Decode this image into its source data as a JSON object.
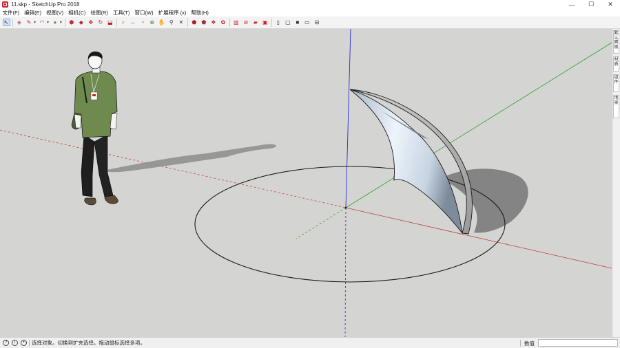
{
  "window": {
    "title": "11.skp - SketchUp Pro 2018",
    "controls": {
      "minimize": "—",
      "maximize": "☐",
      "close": "✕"
    }
  },
  "menu": [
    {
      "label": "文件(F)"
    },
    {
      "label": "编辑(E)"
    },
    {
      "label": "视图(V)"
    },
    {
      "label": "相机(C)"
    },
    {
      "label": "绘图(R)"
    },
    {
      "label": "工具(T)"
    },
    {
      "label": "窗口(W)"
    },
    {
      "label": "扩展程序 (x)"
    },
    {
      "label": "帮助(H)"
    }
  ],
  "toolbar": {
    "items": [
      {
        "name": "select-tool-icon",
        "glyph": "↖",
        "color": "#1a1a1a",
        "selected": true
      },
      {
        "name": "eraser-tool-icon",
        "glyph": "◈",
        "color": "#d0406c"
      },
      {
        "name": "line-tool-icon",
        "glyph": "✎",
        "color": "#b02020",
        "caret": true
      },
      {
        "name": "arc-tool-icon",
        "glyph": "◠",
        "color": "#c03030",
        "caret": true
      },
      {
        "name": "shape-tool-icon",
        "glyph": "●",
        "color": "#8a7a5a",
        "caret": true
      },
      {
        "name": "push-pull-tool-icon",
        "glyph": "⬢",
        "color": "#c03030"
      },
      {
        "name": "offset-tool-icon",
        "glyph": "◆",
        "color": "#c02828"
      },
      {
        "name": "move-tool-icon",
        "glyph": "✥",
        "color": "#c02020"
      },
      {
        "name": "rotate-tool-icon",
        "glyph": "↻",
        "color": "#c02020"
      },
      {
        "name": "scale-tool-icon",
        "glyph": "⬓",
        "color": "#c02020"
      },
      {
        "name": "tape-measure-tool-icon",
        "glyph": "⌕",
        "color": "#a0801a"
      },
      {
        "name": "dimension-tool-icon",
        "glyph": "↔",
        "color": "#555555"
      },
      {
        "name": "protractor-tool-icon",
        "glyph": "◔",
        "color": "#806020"
      },
      {
        "name": "orbit-tool-icon",
        "glyph": "⊛",
        "color": "#2f6d2f"
      },
      {
        "name": "pan-tool-icon",
        "glyph": "✋",
        "color": "#b08040"
      },
      {
        "name": "zoom-tool-icon",
        "glyph": "⚲",
        "color": "#333333"
      },
      {
        "name": "zoom-extents-tool-icon",
        "glyph": "✕",
        "color": "#333333"
      },
      {
        "name": "warehouse-icon",
        "glyph": "⬟",
        "color": "#b02020"
      },
      {
        "name": "extension-warehouse-icon",
        "glyph": "⬟",
        "color": "#a03030"
      },
      {
        "name": "components-icon",
        "glyph": "❖",
        "color": "#a02828"
      },
      {
        "name": "styles-icon",
        "glyph": "✿",
        "color": "#c02020"
      },
      {
        "name": "layout-icon",
        "glyph": "▥",
        "color": "#c02020"
      },
      {
        "name": "section-plane-icon",
        "glyph": "⊘",
        "color": "#c02020"
      },
      {
        "name": "red-folder-icon",
        "glyph": "▰",
        "color": "#d02020"
      },
      {
        "name": "send-to-layout-icon",
        "glyph": "▣",
        "color": "#d02020"
      },
      {
        "name": "iso-view-icon",
        "glyph": "▯",
        "color": "#333333"
      },
      {
        "name": "top-view-icon",
        "glyph": "▢",
        "color": "#333333"
      },
      {
        "name": "front-view-icon",
        "glyph": "■",
        "color": "#333333"
      },
      {
        "name": "right-view-icon",
        "glyph": "▭",
        "color": "#333333"
      },
      {
        "name": "back-view-icon",
        "glyph": "⊟",
        "color": "#333333"
      }
    ]
  },
  "tray": {
    "tabs": [
      {
        "label": "默认面板"
      },
      {
        "label": "材质"
      },
      {
        "label": "组件"
      },
      {
        "label": "场景"
      }
    ]
  },
  "status": {
    "text": "选择对象。切换到扩充选择。拖动鼠标选择多项。",
    "vcb_label": "数值",
    "vcb_value": ""
  },
  "colors": {
    "viewport_bg": "#d4d4d2",
    "axis_red": "#c24040",
    "axis_green": "#2ea02e",
    "axis_blue": "#2a2ad0",
    "shadow": "#8a8a8a",
    "surface_light": "#e8f0f8",
    "surface_dark": "#6f7f90"
  }
}
